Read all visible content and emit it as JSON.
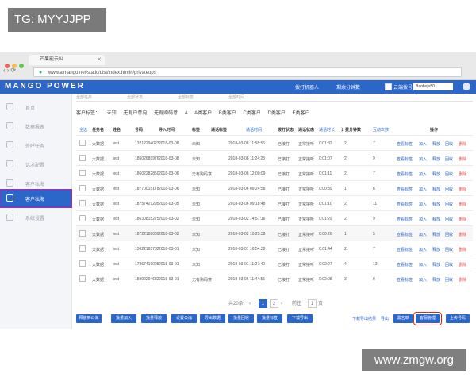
{
  "watermark": {
    "tag": "TG: MYYJJPP",
    "site": "www.zmgw.org"
  },
  "browser": {
    "tab_title": "芒果能云AI",
    "url": "www.aimango.net/static/dist/index.html#/privateops",
    "dot_colors": [
      "#f0625c",
      "#f7be48",
      "#5fc552"
    ]
  },
  "app": {
    "logo": "MANGO POWER",
    "header_items": [
      "拨打机器人",
      "剩余分钟数"
    ],
    "header_checkbox_label": "云端拨号",
    "account": "Baohuju50"
  },
  "sidebar": {
    "items": [
      {
        "label": "首页",
        "active": false
      },
      {
        "label": "数据报表",
        "active": false
      },
      {
        "label": "外呼任务",
        "active": false
      },
      {
        "label": "话术配置",
        "active": false
      },
      {
        "label": "客户私海",
        "active": false
      },
      {
        "label": "客户私海",
        "active": true
      },
      {
        "label": "系统设置",
        "active": false
      }
    ]
  },
  "filters": [
    "全部任务",
    "全部状态",
    "全部标签",
    "全部时间"
  ],
  "tags": {
    "label": "客户标签：",
    "items": [
      "未知",
      "无有户意向",
      "无有购码意",
      "A",
      "A类客户",
      "B类客户",
      "C类客户",
      "D类客户",
      "E类客户"
    ]
  },
  "table": {
    "headers": [
      "全选",
      "任务名",
      "姓名",
      "号码",
      "导入时间",
      "标签",
      "通话标签",
      "通话时间",
      "拨打状态",
      "通话状态",
      "通话时长",
      "计费分钟数",
      "互动次数",
      "操作"
    ],
    "rows": [
      [
        "大数据",
        "test",
        "13212294023",
        "2018-03-08",
        "未知",
        "2018-03-08 11:58:55",
        "已接打",
        "正常接听",
        "0:01:32",
        "2",
        "7"
      ],
      [
        "大数据",
        "test",
        "18502689976",
        "2018-03-08",
        "未知",
        "2018-03-08 11:24:23",
        "已接打",
        "正常接听",
        "0:01:07",
        "2",
        "9"
      ],
      [
        "大数据",
        "test",
        "18602282850",
        "2018-03-06",
        "无有购码意",
        "2018-03-06 12:00:09",
        "已接打",
        "正常接听",
        "0:01:11",
        "2",
        "7"
      ],
      [
        "大数据",
        "test",
        "18770015178",
        "2018-03-06",
        "未知",
        "2018-03-06 09:24:58",
        "已接打",
        "正常接听",
        "0:00:39",
        "1",
        "6"
      ],
      [
        "大数据",
        "test",
        "18757421295",
        "2018-03-05",
        "未知",
        "2018-03-06 09:18:48",
        "已接打",
        "正常接听",
        "0:01:10",
        "2",
        "11"
      ],
      [
        "大数据",
        "test",
        "18630815275",
        "2018-03-02",
        "未知",
        "2018-03-02 14:57:16",
        "已接打",
        "正常接听",
        "0:01:29",
        "2",
        "9"
      ],
      [
        "大数据",
        "test",
        "18722188089",
        "2018-03-02",
        "未知",
        "2018-03-02 10:25:38",
        "已接打",
        "正常接听",
        "0:00:26",
        "1",
        "5"
      ],
      [
        "大数据",
        "test",
        "13622183782",
        "2018-03-01",
        "未知",
        "2018-03-01 16:54:38",
        "已接打",
        "正常接听",
        "0:01:44",
        "2",
        "7"
      ],
      [
        "大数据",
        "test",
        "17867419025",
        "2018-03-01",
        "未知",
        "2018-03-01 11:27:40",
        "已接打",
        "正常接听",
        "0:02:27",
        "4",
        "13"
      ],
      [
        "大数据",
        "test",
        "15902204632",
        "2018-03-01",
        "无有购码意",
        "2018-03-06 11:44:55",
        "已接打",
        "正常接听",
        "0:02:08",
        "3",
        "8"
      ]
    ],
    "ops": [
      "查看标签",
      "加入",
      "释放",
      "回收",
      "删除"
    ]
  },
  "pager": {
    "total": "共20条",
    "pages": [
      "1",
      "2"
    ],
    "current": "1",
    "goto": "前往",
    "goto_value": "1",
    "page_unit": "页"
  },
  "actions": [
    "释放到公海",
    "批量加入",
    "批量释放",
    "设置公海",
    "导出数据",
    "批量回收",
    "批量标签",
    "下载导出"
  ],
  "right_links": [
    "下载导出结果",
    "导出"
  ],
  "right_buttons": [
    "黑名单",
    "客服管理",
    "上传号码"
  ]
}
